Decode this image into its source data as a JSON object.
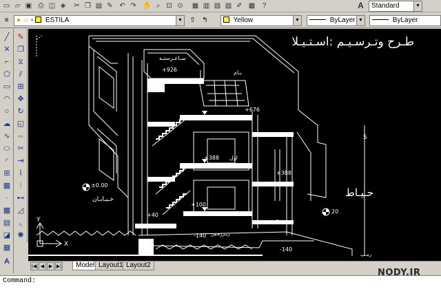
{
  "toolbar_top": {
    "text_style": "Standard",
    "icons": [
      "new-icon",
      "open-icon",
      "save-icon",
      "print-icon",
      "preview-icon",
      "publish-icon",
      "cut-icon",
      "copy-icon",
      "paste-icon",
      "match-icon",
      "undo-icon",
      "redo-icon",
      "pan-icon",
      "zoom-icon",
      "zoom-window-icon",
      "zoom-prev-icon",
      "properties-icon",
      "design-center-icon",
      "tool-palette-icon",
      "sheet-set-icon",
      "markup-icon",
      "calc-icon",
      "help-icon",
      "text-style-icon"
    ]
  },
  "toolbar_layers": {
    "layer_name": "ESTILA",
    "color": "Yellow",
    "color_hex": "#ffff00",
    "linetype": "ByLayer",
    "lineweight": "ByLayer"
  },
  "drawing": {
    "title": "طـرح وتـرسـيـم :اسـتـيـلا",
    "label_hayat": "حـيـاط",
    "label_bam": "بـام",
    "label_khiaban": "خـيـابـان",
    "label_mahrazosh": "سـاعـرستـه",
    "label_awal": "اول",
    "label_hamkaf": "هـمـکـف",
    "label_zirzamin": "زيـرزمـين",
    "label_ramp": "رمـپ",
    "level_926": "+926",
    "level_676": "+676",
    "level_388a": "+388",
    "level_388b": "+388",
    "level_100": "+100",
    "level_40": "+40",
    "level_0": "±0.00",
    "level_140a": "-140",
    "level_140b": "-140",
    "level_20": "20",
    "axis_y": "Y",
    "axis_x": "X",
    "section_mark": "S"
  },
  "tabs": {
    "model": "Model",
    "layout1": "Layout1",
    "layout2": "Layout2"
  },
  "command": {
    "prompt": "Command:"
  },
  "watermark": "NODY.IR"
}
